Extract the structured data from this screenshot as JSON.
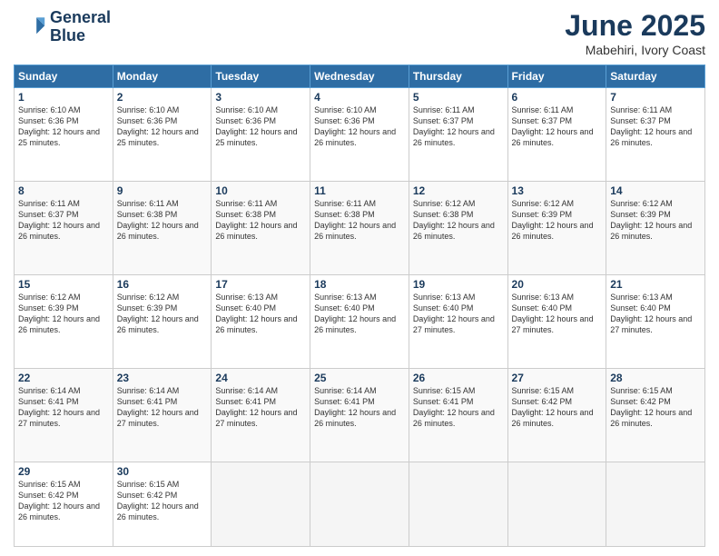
{
  "header": {
    "logo_line1": "General",
    "logo_line2": "Blue",
    "title": "June 2025",
    "location": "Mabehiri, Ivory Coast"
  },
  "weekdays": [
    "Sunday",
    "Monday",
    "Tuesday",
    "Wednesday",
    "Thursday",
    "Friday",
    "Saturday"
  ],
  "weeks": [
    [
      {
        "day": "1",
        "rise": "6:10 AM",
        "set": "6:36 PM",
        "hours": "12 hours and 25 minutes."
      },
      {
        "day": "2",
        "rise": "6:10 AM",
        "set": "6:36 PM",
        "hours": "12 hours and 25 minutes."
      },
      {
        "day": "3",
        "rise": "6:10 AM",
        "set": "6:36 PM",
        "hours": "12 hours and 25 minutes."
      },
      {
        "day": "4",
        "rise": "6:10 AM",
        "set": "6:36 PM",
        "hours": "12 hours and 26 minutes."
      },
      {
        "day": "5",
        "rise": "6:11 AM",
        "set": "6:37 PM",
        "hours": "12 hours and 26 minutes."
      },
      {
        "day": "6",
        "rise": "6:11 AM",
        "set": "6:37 PM",
        "hours": "12 hours and 26 minutes."
      },
      {
        "day": "7",
        "rise": "6:11 AM",
        "set": "6:37 PM",
        "hours": "12 hours and 26 minutes."
      }
    ],
    [
      {
        "day": "8",
        "rise": "6:11 AM",
        "set": "6:37 PM",
        "hours": "12 hours and 26 minutes."
      },
      {
        "day": "9",
        "rise": "6:11 AM",
        "set": "6:38 PM",
        "hours": "12 hours and 26 minutes."
      },
      {
        "day": "10",
        "rise": "6:11 AM",
        "set": "6:38 PM",
        "hours": "12 hours and 26 minutes."
      },
      {
        "day": "11",
        "rise": "6:11 AM",
        "set": "6:38 PM",
        "hours": "12 hours and 26 minutes."
      },
      {
        "day": "12",
        "rise": "6:12 AM",
        "set": "6:38 PM",
        "hours": "12 hours and 26 minutes."
      },
      {
        "day": "13",
        "rise": "6:12 AM",
        "set": "6:39 PM",
        "hours": "12 hours and 26 minutes."
      },
      {
        "day": "14",
        "rise": "6:12 AM",
        "set": "6:39 PM",
        "hours": "12 hours and 26 minutes."
      }
    ],
    [
      {
        "day": "15",
        "rise": "6:12 AM",
        "set": "6:39 PM",
        "hours": "12 hours and 26 minutes."
      },
      {
        "day": "16",
        "rise": "6:12 AM",
        "set": "6:39 PM",
        "hours": "12 hours and 26 minutes."
      },
      {
        "day": "17",
        "rise": "6:13 AM",
        "set": "6:40 PM",
        "hours": "12 hours and 26 minutes."
      },
      {
        "day": "18",
        "rise": "6:13 AM",
        "set": "6:40 PM",
        "hours": "12 hours and 26 minutes."
      },
      {
        "day": "19",
        "rise": "6:13 AM",
        "set": "6:40 PM",
        "hours": "12 hours and 27 minutes."
      },
      {
        "day": "20",
        "rise": "6:13 AM",
        "set": "6:40 PM",
        "hours": "12 hours and 27 minutes."
      },
      {
        "day": "21",
        "rise": "6:13 AM",
        "set": "6:40 PM",
        "hours": "12 hours and 27 minutes."
      }
    ],
    [
      {
        "day": "22",
        "rise": "6:14 AM",
        "set": "6:41 PM",
        "hours": "12 hours and 27 minutes."
      },
      {
        "day": "23",
        "rise": "6:14 AM",
        "set": "6:41 PM",
        "hours": "12 hours and 27 minutes."
      },
      {
        "day": "24",
        "rise": "6:14 AM",
        "set": "6:41 PM",
        "hours": "12 hours and 27 minutes."
      },
      {
        "day": "25",
        "rise": "6:14 AM",
        "set": "6:41 PM",
        "hours": "12 hours and 26 minutes."
      },
      {
        "day": "26",
        "rise": "6:15 AM",
        "set": "6:41 PM",
        "hours": "12 hours and 26 minutes."
      },
      {
        "day": "27",
        "rise": "6:15 AM",
        "set": "6:42 PM",
        "hours": "12 hours and 26 minutes."
      },
      {
        "day": "28",
        "rise": "6:15 AM",
        "set": "6:42 PM",
        "hours": "12 hours and 26 minutes."
      }
    ],
    [
      {
        "day": "29",
        "rise": "6:15 AM",
        "set": "6:42 PM",
        "hours": "12 hours and 26 minutes."
      },
      {
        "day": "30",
        "rise": "6:15 AM",
        "set": "6:42 PM",
        "hours": "12 hours and 26 minutes."
      },
      null,
      null,
      null,
      null,
      null
    ]
  ]
}
